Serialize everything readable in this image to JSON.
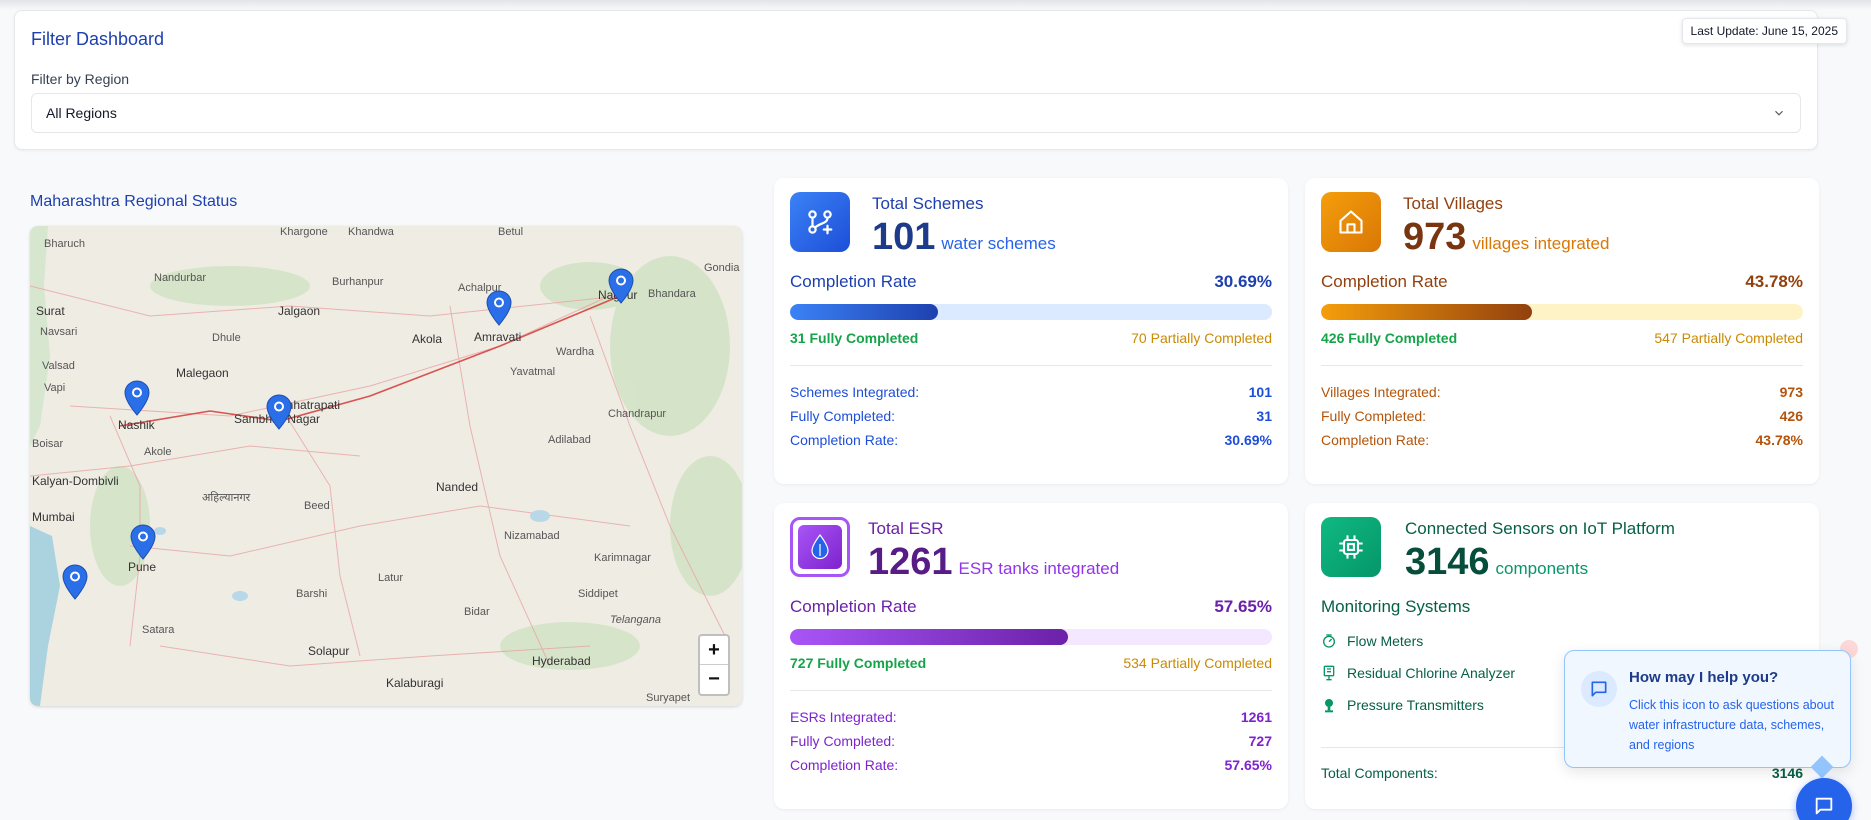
{
  "filter": {
    "title": "Filter Dashboard",
    "label": "Filter by Region",
    "selected": "All Regions",
    "last_update": "Last Update: June 15, 2025"
  },
  "map": {
    "title": "Maharashtra Regional Status",
    "labels": [
      "Bharuch",
      "Khargone",
      "Khandwa",
      "Betul",
      "Nandurbar",
      "Burhanpur",
      "Achalpur",
      "Nagpur",
      "Bhandara",
      "Gondia",
      "Surat",
      "Jalgaon",
      "Amravati",
      "Navsari",
      "Dhule",
      "Akola",
      "Wardha",
      "Valsad",
      "Malegaon",
      "Yavatmal",
      "Vapi",
      "Nashik",
      "Chhatrapati",
      "Sambhaji Nagar",
      "Chandrapur",
      "Boisar",
      "Akole",
      "Adilabad",
      "Kalyan-Dombivli",
      "Nanded",
      "अहिल्यानगर",
      "Mumbai",
      "Beed",
      "Nizamabad",
      "Karimnagar",
      "Pune",
      "Latur",
      "Siddipet",
      "Barshi",
      "Bidar",
      "Satara",
      "Telangana",
      "Solapur",
      "Hyderabad",
      "Kalaburagi",
      "Suryapet"
    ],
    "zoom_in": "+",
    "zoom_out": "−"
  },
  "schemes": {
    "title": "Total Schemes",
    "value": "101",
    "unit": "water schemes",
    "rate_label": "Completion Rate",
    "rate": "30.69%",
    "progress": 0.3069,
    "fully": "31 Fully Completed",
    "partial": "70 Partially Completed",
    "stats": [
      {
        "label": "Schemes Integrated:",
        "value": "101"
      },
      {
        "label": "Fully Completed:",
        "value": "31"
      },
      {
        "label": "Completion Rate:",
        "value": "30.69%"
      }
    ]
  },
  "villages": {
    "title": "Total Villages",
    "value": "973",
    "unit": "villages integrated",
    "rate_label": "Completion Rate",
    "rate": "43.78%",
    "progress": 0.4378,
    "fully": "426 Fully Completed",
    "partial": "547 Partially Completed",
    "stats": [
      {
        "label": "Villages Integrated:",
        "value": "973"
      },
      {
        "label": "Fully Completed:",
        "value": "426"
      },
      {
        "label": "Completion Rate:",
        "value": "43.78%"
      }
    ]
  },
  "esr": {
    "title": "Total ESR",
    "value": "1261",
    "unit": "ESR tanks integrated",
    "rate_label": "Completion Rate",
    "rate": "57.65%",
    "progress": 0.5765,
    "fully": "727 Fully Completed",
    "partial": "534 Partially Completed",
    "stats": [
      {
        "label": "ESRs Integrated:",
        "value": "1261"
      },
      {
        "label": "Fully Completed:",
        "value": "727"
      },
      {
        "label": "Completion Rate:",
        "value": "57.65%"
      }
    ]
  },
  "sensors": {
    "title": "Connected Sensors on IoT Platform",
    "value": "3146",
    "unit": "components",
    "monitoring_title": "Monitoring Systems",
    "items": [
      "Flow Meters",
      "Residual Chlorine Analyzer",
      "Pressure Transmitters"
    ],
    "total_label": "Total Components:",
    "total_value": "3146"
  },
  "help": {
    "title": "How may I help you?",
    "text": "Click this icon to ask questions about water infrastructure data, schemes, and regions"
  },
  "colors": {
    "schemes": "#1e40af",
    "villages": "#92400e",
    "esr": "#6b21a8",
    "sensors": "#065f46"
  }
}
